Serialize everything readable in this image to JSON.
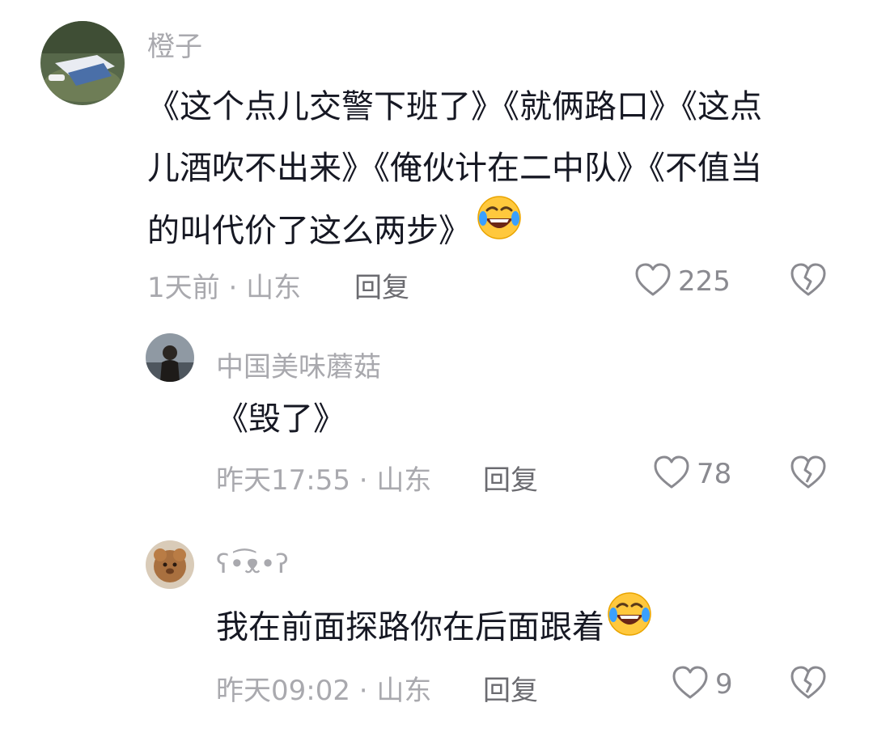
{
  "comments": [
    {
      "username": "橙子",
      "text": "《这个点儿交警下班了》《就俩路口》《这点儿酒吹不出来》《俺伙计在二中队》《不值当的叫代价了这么两步》",
      "emoji": "rolling-laughing-emoji",
      "time": "1天前",
      "sep": "·",
      "location": "山东",
      "reply_label": "回复",
      "likes": "225",
      "icons": {
        "like": "heart-outline-icon",
        "dislike": "broken-heart-icon"
      }
    },
    {
      "username": "中国美味蘑菇",
      "text": "《毁了》",
      "time": "昨天17:55",
      "sep": "·",
      "location": "山东",
      "reply_label": "回复",
      "likes": "78"
    },
    {
      "username": "ʕ•͡ᴥ•ʔ",
      "text": "我在前面探路你在后面跟着",
      "emoji": "rolling-laughing-emoji",
      "time": "昨天09:02",
      "sep": "·",
      "location": "山东",
      "reply_label": "回复",
      "likes": "9"
    }
  ],
  "colors": {
    "username": "#a9a9ae",
    "text": "#161823",
    "meta": "#a9a9ae",
    "reply": "#6b6b70",
    "icon": "#8a8a90",
    "emoji_face": "#ffc83d"
  }
}
